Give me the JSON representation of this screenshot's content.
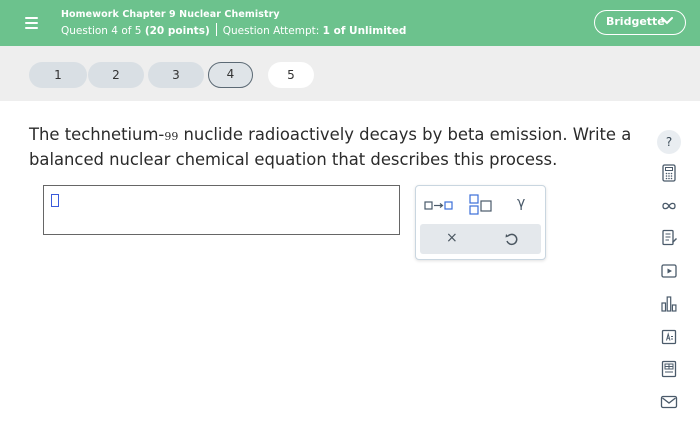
{
  "header": {
    "title": "Homework Chapter 9 Nuclear Chemistry",
    "question_prefix": "Question 4 of 5",
    "points": "(20 points)",
    "attempt_prefix": "Question Attempt:",
    "attempt_value": "1 of Unlimited",
    "user_name": "Bridgette"
  },
  "question_nav": {
    "items": [
      "1",
      "2",
      "3",
      "4",
      "5"
    ],
    "current": "4"
  },
  "question": {
    "text_before": "The technetium-",
    "mass_number": "99",
    "text_after": " nuclide radioactively decays by beta emission. Write a balanced nuclear chemical equation that describes this process."
  },
  "answer_input": {
    "value": ""
  },
  "tools": {
    "gamma_symbol": "γ",
    "clear_symbol": "×"
  },
  "help": {
    "label": "?"
  },
  "colors": {
    "header_green": "#6cc28d",
    "nav_bg": "#eeeeee",
    "pill_bg": "#d9dfe4",
    "cursor_blue": "#3b5bdb"
  },
  "icons": {
    "sidebar": [
      "calculator-icon",
      "infinity-icon",
      "notes-icon",
      "video-icon",
      "chart-icon",
      "periodic-table-icon",
      "reference-icon",
      "mail-icon"
    ]
  }
}
